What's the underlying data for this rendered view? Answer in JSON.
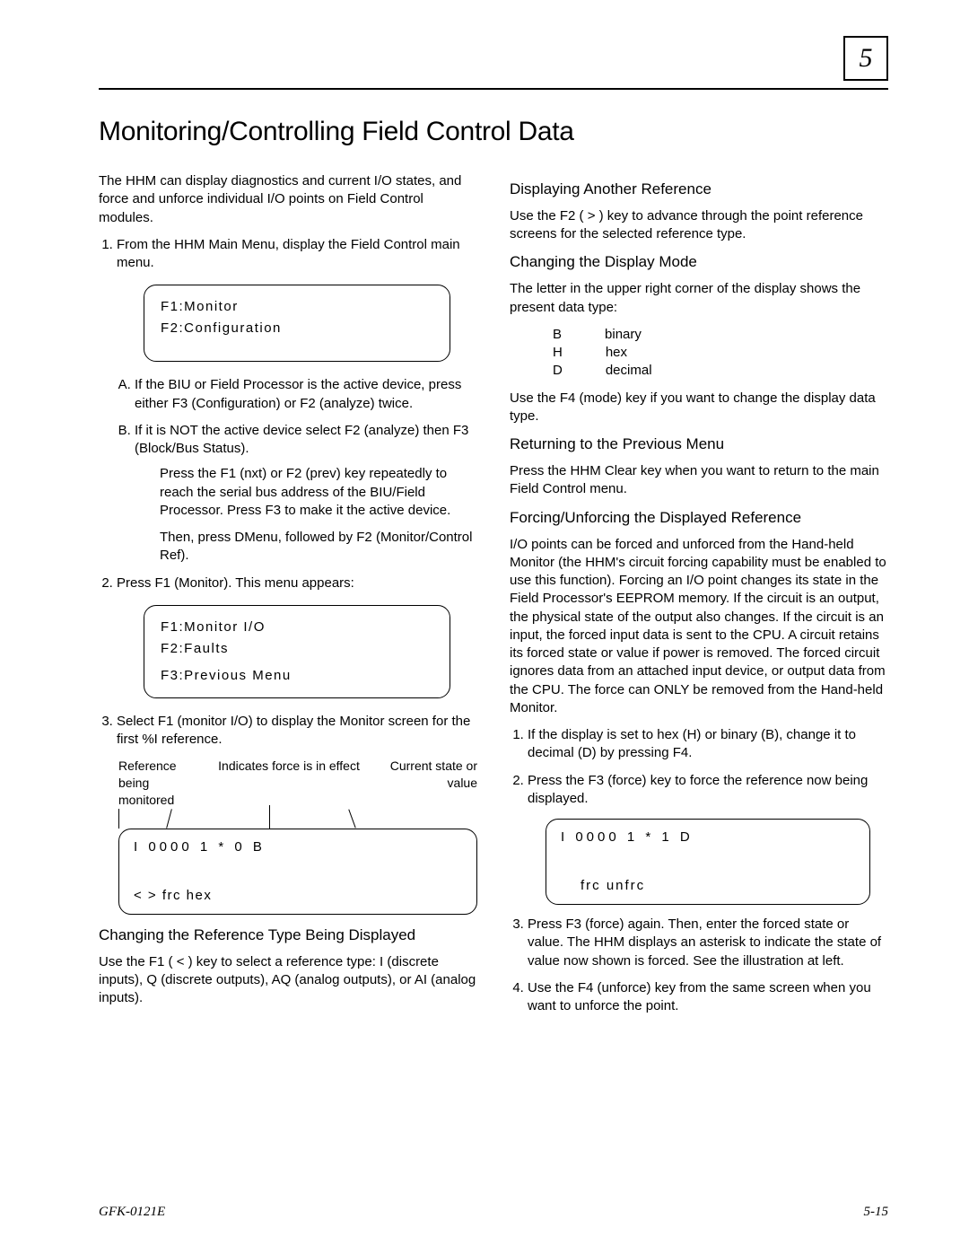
{
  "chapter_number": "5",
  "title": "Monitoring/Controlling Field Control Data",
  "left": {
    "intro": "The HHM can display diagnostics and current I/O states, and force and unforce individual I/O points on Field Control modules.",
    "step1": "From the HHM Main Menu, display the Field Control main menu.",
    "lcd1_l1": "F1:Monitor",
    "lcd1_l2": "F2:Configuration",
    "stepA": "If the BIU or Field Processor is the active device,  press either F3 (Configuration) or F2 (analyze) twice.",
    "stepB": "If it is NOT the active device select F2 (analyze) then F3 (Block/Bus Status).",
    "stepB_p1": "Press the F1 (nxt) or F2 (prev) key repeatedly to reach the serial bus address of the BIU/Field Processor. Press F3 to make it the active device.",
    "stepB_p2": "Then, press DMenu, followed by F2 (Monitor/Control   Ref).",
    "step2": "Press F1 (Monitor). This menu appears:",
    "lcd2_l1": "F1:Monitor I/O",
    "lcd2_l2": "F2:Faults",
    "lcd2_l3": "F3:Previous Menu",
    "step3": "Select F1 (monitor I/O) to display the Monitor screen for the first %I reference.",
    "diag_ref": "Reference being monitored",
    "diag_force": "Indicates force is in effect",
    "diag_current": "Current state or value",
    "mon_row1": "I 0000 1  * 0      B",
    "mon_row2": "<  > frc hex",
    "h_changing_type": "Changing the Reference Type Being Displayed",
    "changing_type_body": "Use the F1 ( < )  key to select a reference type: I (discrete inputs), Q (discrete outputs), AQ (analog outputs), or AI (analog inputs)."
  },
  "right": {
    "h_another": "Displaying Another Reference",
    "another_body": "Use the F2 ( > ) key to advance through the point reference screens for the selected reference type.",
    "h_mode": "Changing the Display Mode",
    "mode_intro": "The letter in the upper right corner of the display shows the present data type:",
    "mode_B_k": "B",
    "mode_B_v": "binary",
    "mode_H_k": "H",
    "mode_H_v": "hex",
    "mode_D_k": "D",
    "mode_D_v": "decimal",
    "mode_body2": "Use the F4 (mode) key if you want to change the display data type.",
    "h_return": "Returning to the Previous Menu",
    "return_body": "Press the HHM Clear key when you want to return to the main Field Control menu.",
    "h_force": "Forcing/Unforcing the Displayed Reference",
    "force_body": "I/O points can be forced and unforced from the Hand-held Monitor (the HHM's circuit forcing capability must be enabled to use this function). Forcing an I/O point changes its state in the Field Processor's EEPROM memory.  If the circuit is an output, the physical state of the output also changes.  If the circuit is an input, the forced input data is sent to the CPU.  A circuit retains its forced state or value if power is removed.  The forced circuit ignores data from an attached input device, or output data from the CPU.  The force can ONLY be removed from the Hand-held Monitor.",
    "f_step1": "If the display is set to hex (H) or binary (B), change it to decimal (D) by pressing F4.",
    "f_step2": "Press the F3 (force) key to force the reference now being displayed.",
    "frc_row1": "I 0000 1  * 1      D",
    "frc_row2": "frc unfrc",
    "f_step3": "Press F3 (force) again. Then, enter the forced state or value. The HHM displays an asterisk to indicate the state of value now shown is forced. See the illustration at left.",
    "f_step4": "Use the F4  (unforce) key from the same screen when you want to unforce the point."
  },
  "footer_left": "GFK-0121E",
  "footer_right": "5-15"
}
